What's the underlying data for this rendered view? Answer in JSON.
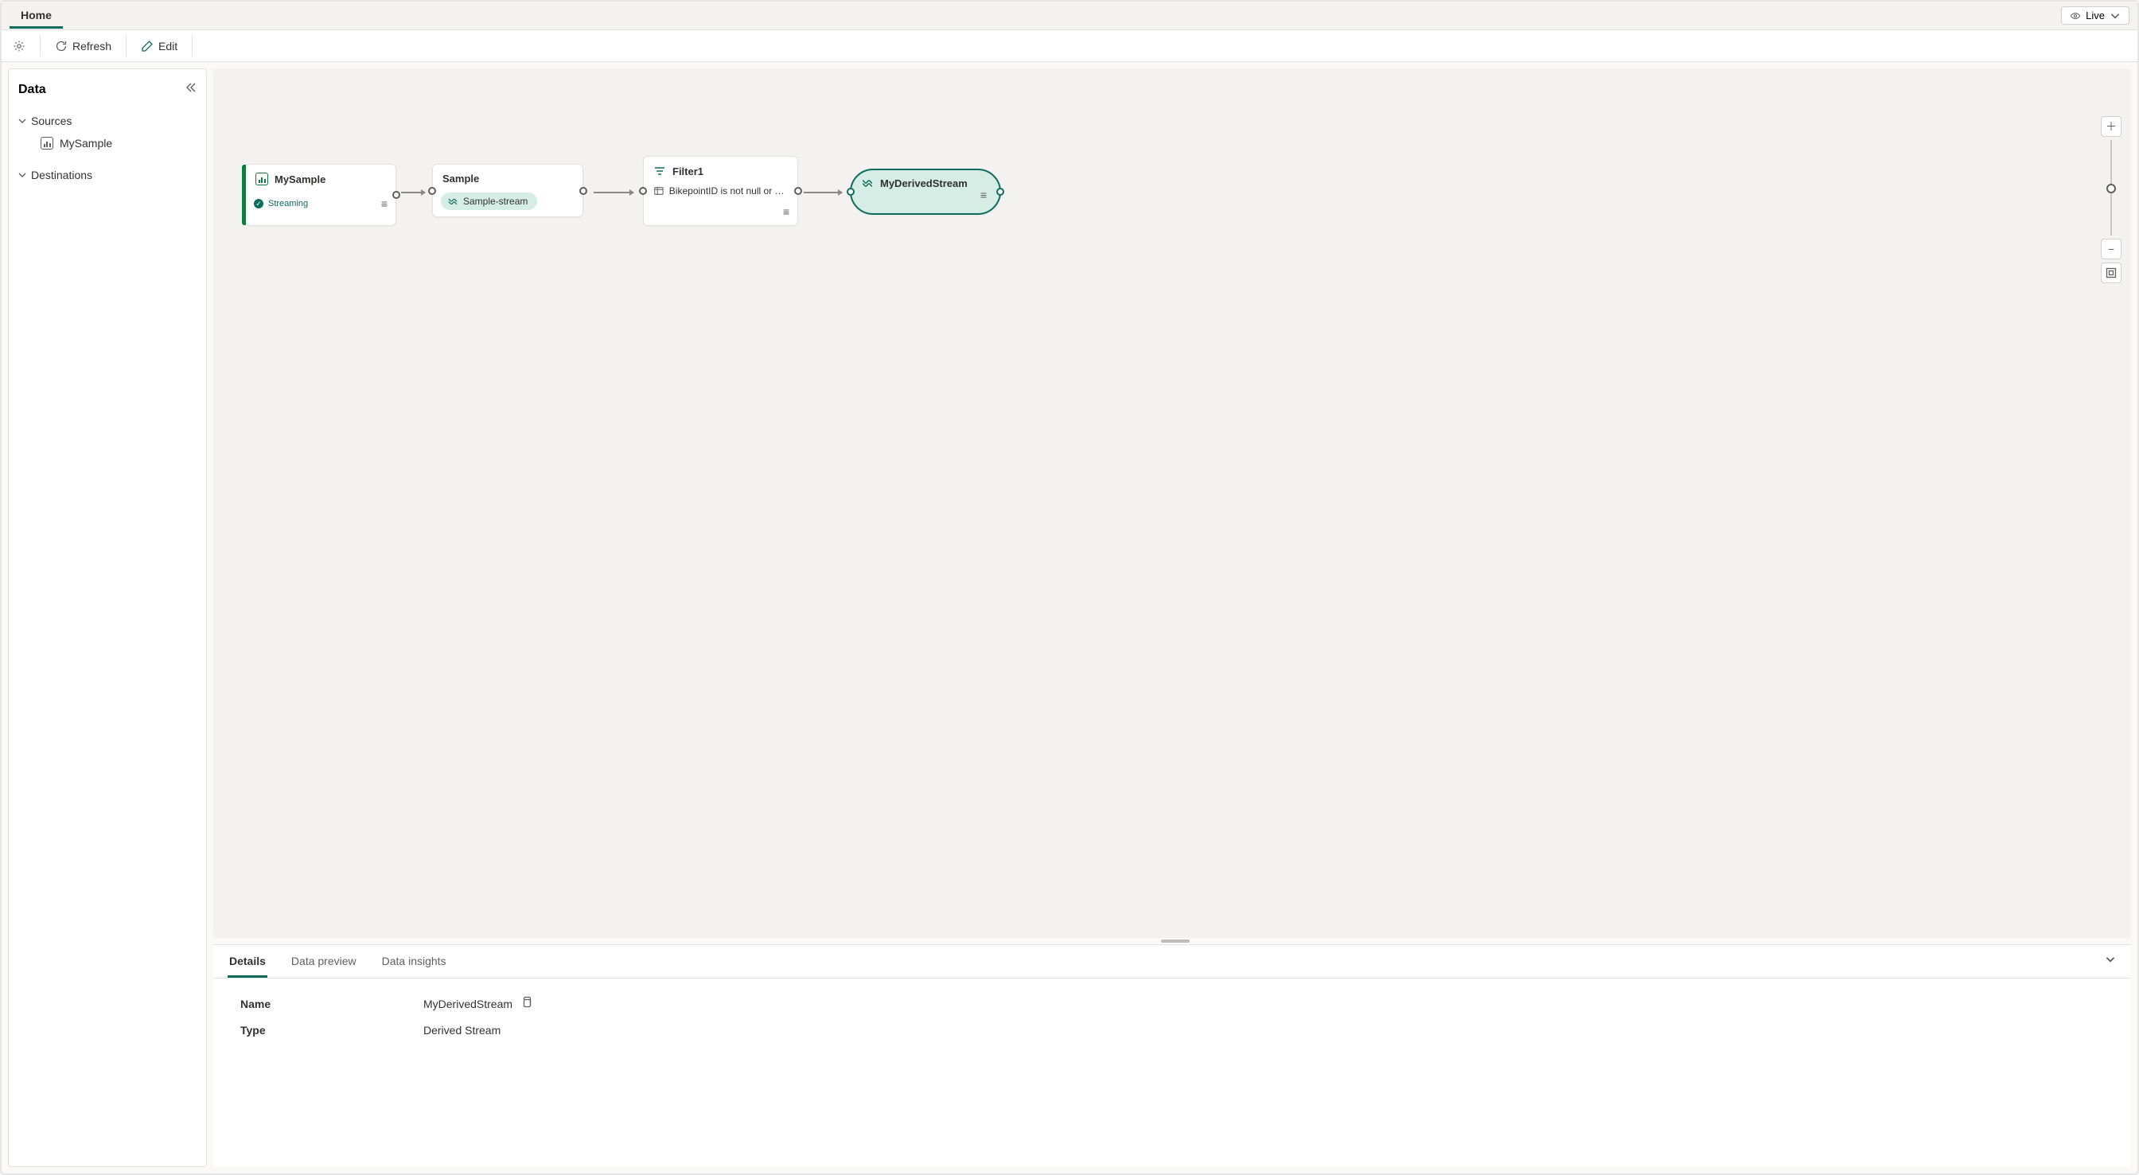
{
  "tabs": {
    "home": "Home"
  },
  "mode": {
    "label": "Live"
  },
  "toolbar": {
    "refresh": "Refresh",
    "edit": "Edit"
  },
  "sidebar": {
    "title": "Data",
    "sections": {
      "sources": "Sources",
      "destinations": "Destinations"
    },
    "items": {
      "mysample": "MySample"
    }
  },
  "nodes": {
    "source": {
      "title": "MySample",
      "status": "Streaming"
    },
    "sample": {
      "title": "Sample",
      "chip": "Sample-stream"
    },
    "filter": {
      "title": "Filter1",
      "expr": "BikepointID is not null or e…"
    },
    "sink": {
      "title": "MyDerivedStream"
    }
  },
  "detailsTabs": {
    "details": "Details",
    "preview": "Data preview",
    "insights": "Data insights"
  },
  "details": {
    "nameLabel": "Name",
    "nameValue": "MyDerivedStream",
    "typeLabel": "Type",
    "typeValue": "Derived Stream"
  }
}
